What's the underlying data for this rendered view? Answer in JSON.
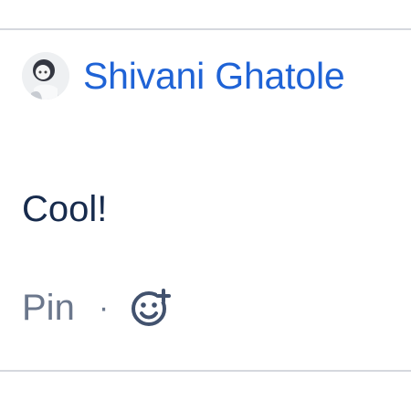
{
  "comment": {
    "author": {
      "name": "Shivani Ghatole",
      "avatar_icon": "user-avatar-icon",
      "name_color": "#1f63d6"
    },
    "body": "Cool!",
    "actions": {
      "pin_label": "Pin",
      "separator": "·",
      "reaction_icon": "add-reaction-icon"
    }
  },
  "colors": {
    "divider": "#d5d8de",
    "body_text": "#172b4d",
    "secondary_text": "#6b778c"
  }
}
